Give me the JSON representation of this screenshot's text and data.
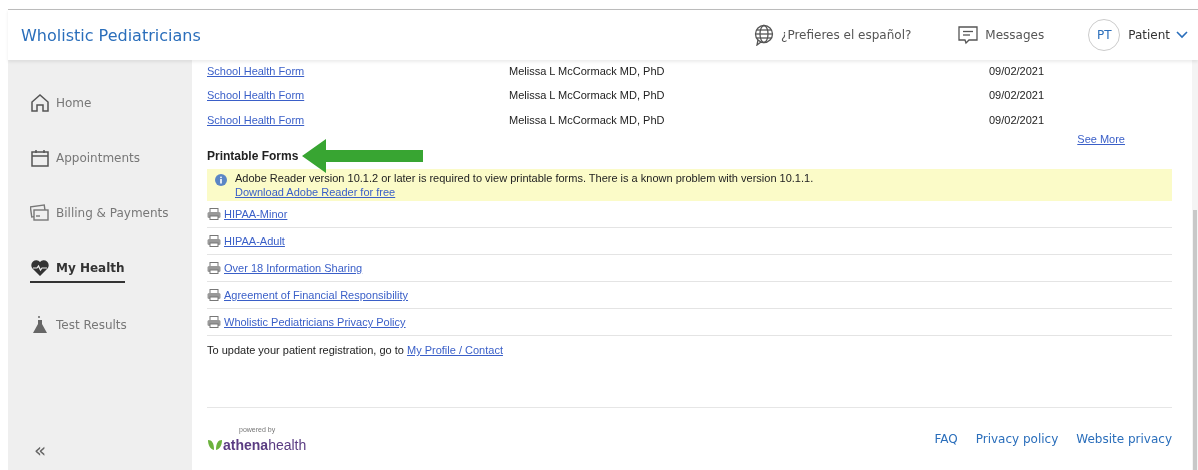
{
  "header": {
    "practice_name": "Wholistic Pediatricians",
    "language_link": "¿Prefieres el español?",
    "messages": "Messages",
    "avatar_initials": "PT",
    "user_menu": "Patient"
  },
  "sidebar": {
    "items": [
      {
        "label": "Home",
        "selected": false
      },
      {
        "label": "Appointments",
        "selected": false
      },
      {
        "label": "Billing & Payments",
        "selected": false
      },
      {
        "label": "My Health",
        "selected": true
      },
      {
        "label": "Test Results",
        "selected": false
      }
    ],
    "collapse": "«"
  },
  "documents": {
    "rows": [
      {
        "name": "School Health Form",
        "provider": "Melissa L McCormack MD, PhD",
        "date": "09/02/2021"
      },
      {
        "name": "School Health Form",
        "provider": "Melissa L McCormack MD, PhD",
        "date": "09/02/2021"
      },
      {
        "name": "School Health Form",
        "provider": "Melissa L McCormack MD, PhD",
        "date": "09/02/2021"
      }
    ],
    "see_more": "See More"
  },
  "printable_forms": {
    "title": "Printable Forms",
    "notice": "Adobe Reader version 10.1.2 or later is required to view printable forms. There is a known problem with version 10.1.1.",
    "notice_link": "Download Adobe Reader for free",
    "forms": [
      "HIPAA-Minor",
      "HIPAA-Adult",
      "Over 18 Information Sharing",
      "Agreement of Financial Responsibility",
      "Wholistic Pediatricians Privacy Policy"
    ],
    "update_text": "To update your patient registration, go to",
    "update_link": "My Profile / Contact"
  },
  "footer": {
    "powered_by": "powered by",
    "logo": "**athena**health",
    "links": [
      "FAQ",
      "Privacy policy",
      "Website privacy"
    ]
  }
}
